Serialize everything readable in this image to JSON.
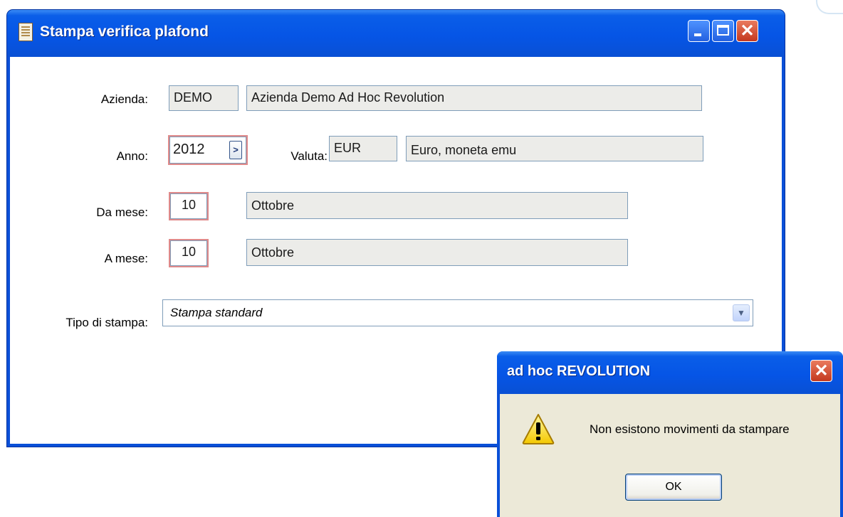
{
  "main_window": {
    "title": "Stampa verifica plafond",
    "buttons": {
      "minimize": "minimize",
      "maximize": "maximize",
      "close": "close"
    }
  },
  "form": {
    "azienda": {
      "label": "Azienda:",
      "code": "DEMO",
      "description": "Azienda Demo Ad Hoc Revolution"
    },
    "anno": {
      "label": "Anno:",
      "value": "2012"
    },
    "valuta": {
      "label": "Valuta:",
      "code": "EUR",
      "description": "Euro, moneta emu"
    },
    "da_mese": {
      "label": "Da mese:",
      "value": "10",
      "description": "Ottobre"
    },
    "a_mese": {
      "label": "A mese:",
      "value": "10",
      "description": "Ottobre"
    },
    "tipo_stampa": {
      "label": "Tipo di stampa:",
      "selected": "Stampa standard"
    }
  },
  "message_box": {
    "title": "ad hoc REVOLUTION",
    "text": "Non esistono movimenti da stampare",
    "ok_label": "OK",
    "icon": "warning-icon"
  },
  "colors": {
    "title_bar": "#0655e6",
    "readonly_field": "#ecece9",
    "dialog_face": "#ece9d8",
    "required_border": "#e08a8a"
  }
}
